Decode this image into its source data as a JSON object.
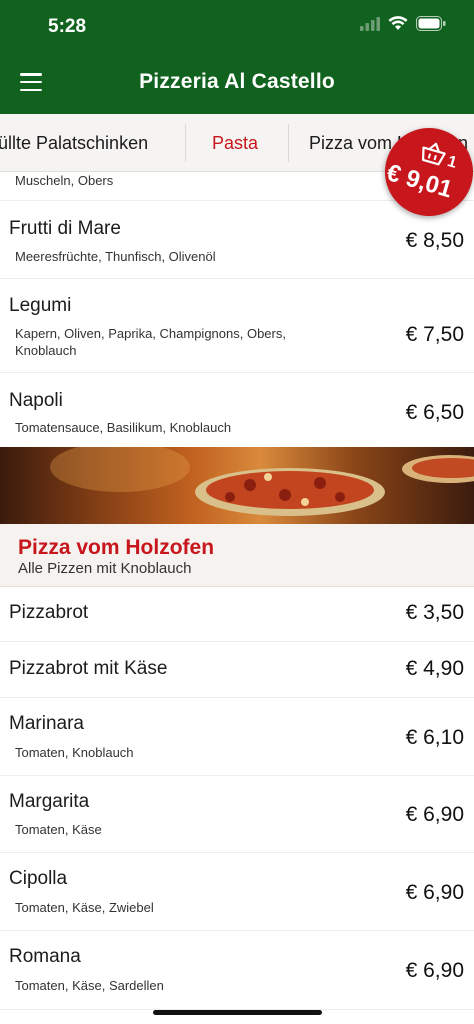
{
  "status_bar": {
    "time": "5:28"
  },
  "header": {
    "title": "Pizzeria Al Castello"
  },
  "tabs": [
    {
      "label": "üllte Palatschinken",
      "active": false
    },
    {
      "label": "Pasta",
      "active": true
    },
    {
      "label": "Pizza vom Holzofen",
      "active": false
    }
  ],
  "cart": {
    "count": "1",
    "total": "€ 9,01"
  },
  "pasta_items": [
    {
      "name": "",
      "desc": "Muscheln, Obers",
      "price": ""
    },
    {
      "name": "Frutti di Mare",
      "desc": "Meeresfrüchte, Thunfisch, Olivenöl",
      "price": "€ 8,50"
    },
    {
      "name": "Legumi",
      "desc": "Kapern, Oliven, Paprika, Champignons, Obers, Knoblauch",
      "price": "€ 7,50"
    },
    {
      "name": "Napoli",
      "desc": "Tomatensauce, Basilikum, Knoblauch",
      "price": "€ 6,50"
    }
  ],
  "section": {
    "title": "Pizza vom Holzofen",
    "subtitle": "Alle Pizzen mit Knoblauch"
  },
  "pizza_items": [
    {
      "name": "Pizzabrot",
      "desc": "",
      "price": "€ 3,50"
    },
    {
      "name": "Pizzabrot mit Käse",
      "desc": "",
      "price": "€ 4,90"
    },
    {
      "name": "Marinara",
      "desc": "Tomaten, Knoblauch",
      "price": "€ 6,10"
    },
    {
      "name": "Margarita",
      "desc": "Tomaten, Käse",
      "price": "€ 6,90"
    },
    {
      "name": "Cipolla",
      "desc": "Tomaten, Käse, Zwiebel",
      "price": "€ 6,90"
    },
    {
      "name": "Romana",
      "desc": "Tomaten, Käse, Sardellen",
      "price": "€ 6,90"
    }
  ],
  "colors": {
    "appbar": "#11621f",
    "accent_red": "#c8161d"
  }
}
